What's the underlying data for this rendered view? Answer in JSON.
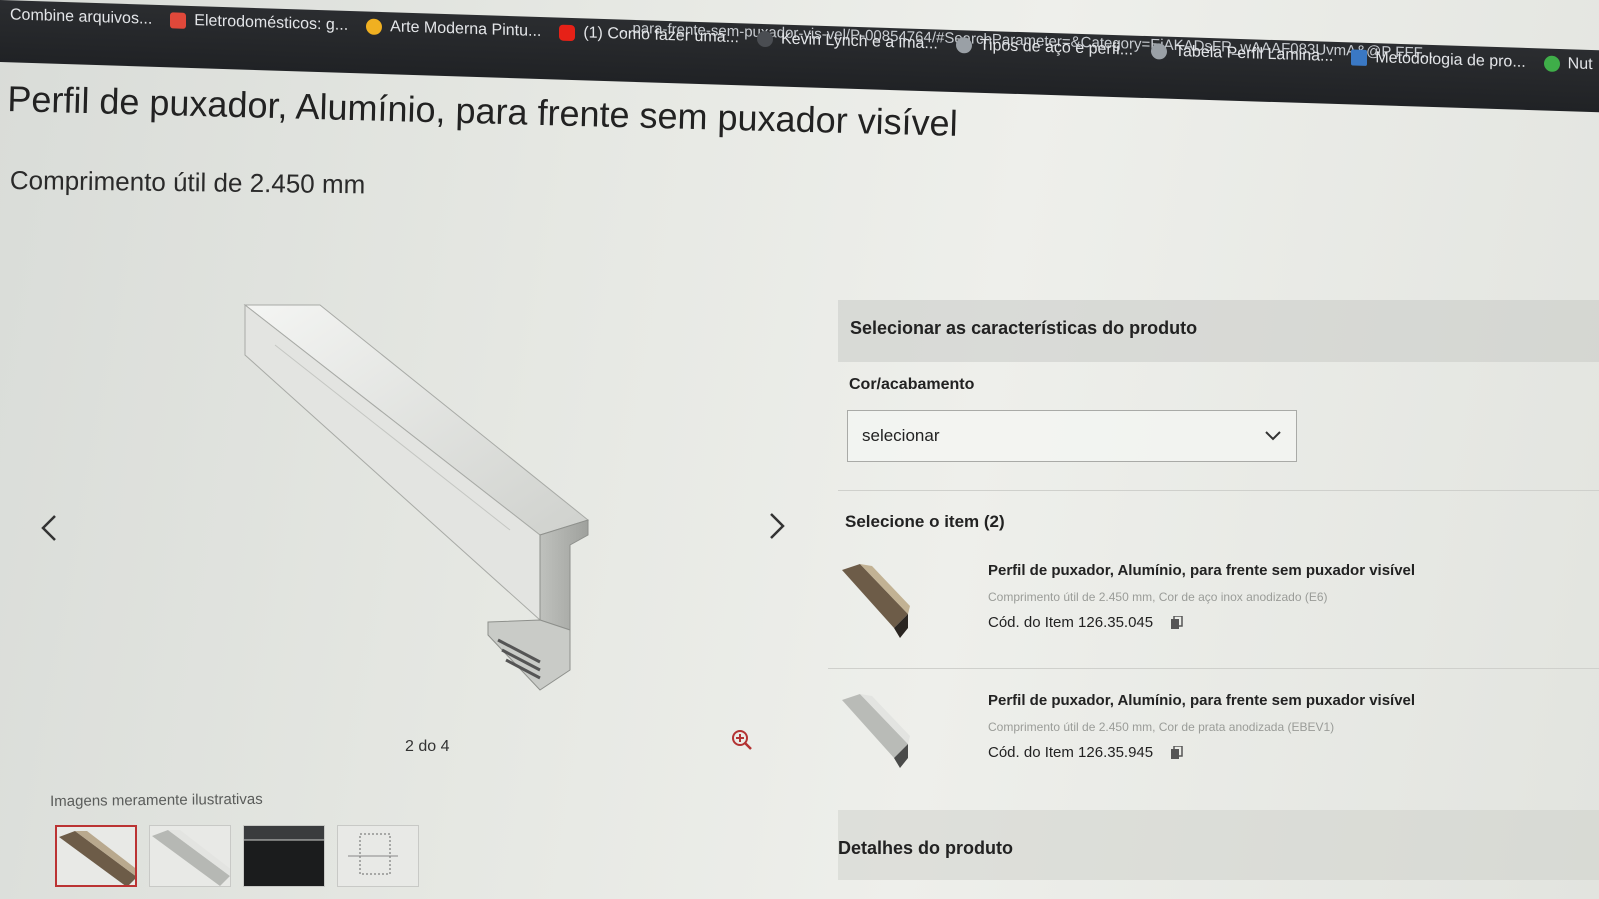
{
  "browser": {
    "url_fragment": "...para-frente-sem-puxador-vis-vel/P-00854764/#SearchParameter=&Category=EjAKADsFR_wAAAF083UvmA&@P FFF...",
    "bookmarks": [
      {
        "label": "Combine arquivos...",
        "icon": "none",
        "color": ""
      },
      {
        "label": "Eletrodomésticos: g...",
        "icon": "house-icon",
        "color": "#e0483a"
      },
      {
        "label": "Arte Moderna Pintu...",
        "icon": "circle-icon",
        "color": "#f0b021"
      },
      {
        "label": "(1) Como fazer uma...",
        "icon": "youtube-icon",
        "color": "#e62117"
      },
      {
        "label": "Kevin Lynch e a ima...",
        "icon": "v-icon",
        "color": "#7a7d82"
      },
      {
        "label": "Tipos de aço e perfi...",
        "icon": "globe-icon",
        "color": "#9aa0a6"
      },
      {
        "label": "Tabela Perfil Lamina...",
        "icon": "globe-icon",
        "color": "#9aa0a6"
      },
      {
        "label": "Metodologia de pro...",
        "icon": "m-icon",
        "color": "#3a78c4"
      },
      {
        "label": "Nut",
        "icon": "n-icon",
        "color": "#3fae49"
      }
    ]
  },
  "product": {
    "title": "Perfil de puxador, Alumínio, para frente sem puxador visível",
    "subtitle": "Comprimento útil de 2.450 mm"
  },
  "gallery": {
    "counter": "2 do 4",
    "disclaimer": "Imagens meramente ilustrativas",
    "thumb_count": 4,
    "active_thumb": 1
  },
  "panel": {
    "header": "Selecionar as características do produto",
    "color_label": "Cor/acabamento",
    "select_value": "selecionar",
    "items_label": "Selecione o item (2)",
    "items": [
      {
        "name": "Perfil de puxador, Alumínio, para frente sem puxador visível",
        "desc": "Comprimento útil de 2.450 mm, Cor de aço inox anodizado (E6)",
        "code": "Cód. do Item 126.35.045",
        "swatch": "#7a6a55"
      },
      {
        "name": "Perfil de puxador, Alumínio, para frente sem puxador visível",
        "desc": "Comprimento útil de 2.450 mm, Cor de prata anodizada (EBEV1)",
        "code": "Cód. do Item 126.35.945",
        "swatch": "#c7c9c4"
      }
    ],
    "details_label": "Detalhes do produto"
  },
  "colors": {
    "accent": "#b33333",
    "bar": "#202225"
  }
}
